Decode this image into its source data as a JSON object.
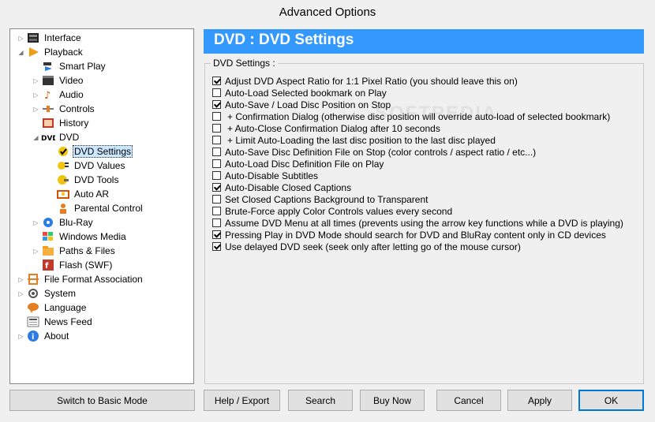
{
  "window": {
    "title": "Advanced Options"
  },
  "tree": [
    {
      "label": "Interface",
      "expander": "▷",
      "icon": "interface-icon"
    },
    {
      "label": "Playback",
      "expander": "◢",
      "icon": "playback-icon"
    },
    {
      "label": "Smart Play",
      "expander": "",
      "icon": "smart-play-icon"
    },
    {
      "label": "Video",
      "expander": "▷",
      "icon": "video-icon"
    },
    {
      "label": "Audio",
      "expander": "▷",
      "icon": "audio-icon"
    },
    {
      "label": "Controls",
      "expander": "▷",
      "icon": "controls-icon"
    },
    {
      "label": "History",
      "expander": "",
      "icon": "history-icon"
    },
    {
      "label": "DVD",
      "expander": "◢",
      "icon": "dvd-icon"
    },
    {
      "label": "DVD Settings",
      "expander": "",
      "icon": "dvd-settings-icon"
    },
    {
      "label": "DVD Values",
      "expander": "",
      "icon": "dvd-values-icon"
    },
    {
      "label": "DVD Tools",
      "expander": "",
      "icon": "dvd-tools-icon"
    },
    {
      "label": "Auto AR",
      "expander": "",
      "icon": "auto-ar-icon"
    },
    {
      "label": "Parental Control",
      "expander": "",
      "icon": "parental-control-icon"
    },
    {
      "label": "Blu-Ray",
      "expander": "▷",
      "icon": "blu-ray-icon"
    },
    {
      "label": "Windows Media",
      "expander": "",
      "icon": "windows-media-icon"
    },
    {
      "label": "Paths & Files",
      "expander": "▷",
      "icon": "paths-files-icon"
    },
    {
      "label": "Flash (SWF)",
      "expander": "",
      "icon": "flash-icon"
    },
    {
      "label": "File Format Association",
      "expander": "▷",
      "icon": "file-format-icon"
    },
    {
      "label": "System",
      "expander": "▷",
      "icon": "system-icon"
    },
    {
      "label": "Language",
      "expander": "",
      "icon": "language-icon"
    },
    {
      "label": "News Feed",
      "expander": "",
      "icon": "news-feed-icon"
    },
    {
      "label": "About",
      "expander": "▷",
      "icon": "about-icon"
    }
  ],
  "selected": "DVD Settings",
  "header": {
    "title": "DVD : DVD Settings"
  },
  "group": {
    "title": "DVD Settings :"
  },
  "options": [
    {
      "label": "Adjust DVD Aspect Ratio for 1:1 Pixel Ratio (you should leave this on)",
      "checked": true
    },
    {
      "label": "Auto-Load Selected bookmark on Play",
      "checked": false
    },
    {
      "label": "Auto-Save / Load Disc Position on Stop",
      "checked": true
    },
    {
      "label": "+ Confirmation Dialog (otherwise disc position will override auto-load of selected bookmark)",
      "checked": false
    },
    {
      "label": "+ Auto-Close Confirmation Dialog after 10 seconds",
      "checked": false
    },
    {
      "label": "+ Limit Auto-Loading the last disc position to the last disc played",
      "checked": false
    },
    {
      "label": "Auto-Save Disc Definition File on Stop (color controls / aspect ratio / etc...)",
      "checked": false
    },
    {
      "label": "Auto-Load Disc Definition File on Play",
      "checked": false
    },
    {
      "label": "Auto-Disable Subtitles",
      "checked": false
    },
    {
      "label": "Auto-Disable Closed Captions",
      "checked": true
    },
    {
      "label": "Set Closed Captions Background to Transparent",
      "checked": false
    },
    {
      "label": "Brute-Force apply Color Controls values every second",
      "checked": false
    },
    {
      "label": "Assume DVD Menu at all times (prevents using the arrow key functions while a DVD is playing)",
      "checked": false
    },
    {
      "label": "Pressing Play in DVD Mode should search for DVD and BluRay content only in CD devices",
      "checked": true
    },
    {
      "label": "Use delayed DVD seek (seek only after letting go of the mouse cursor)",
      "checked": true
    }
  ],
  "buttons": {
    "basic_mode": "Switch to Basic Mode",
    "help_export": "Help / Export",
    "search": "Search",
    "buy_now": "Buy Now",
    "cancel": "Cancel",
    "apply": "Apply",
    "ok": "OK"
  },
  "watermark": "SOFTPEDIA",
  "colors": {
    "header_bg": "#3399ff",
    "selection_bg": "#cce8ff"
  }
}
